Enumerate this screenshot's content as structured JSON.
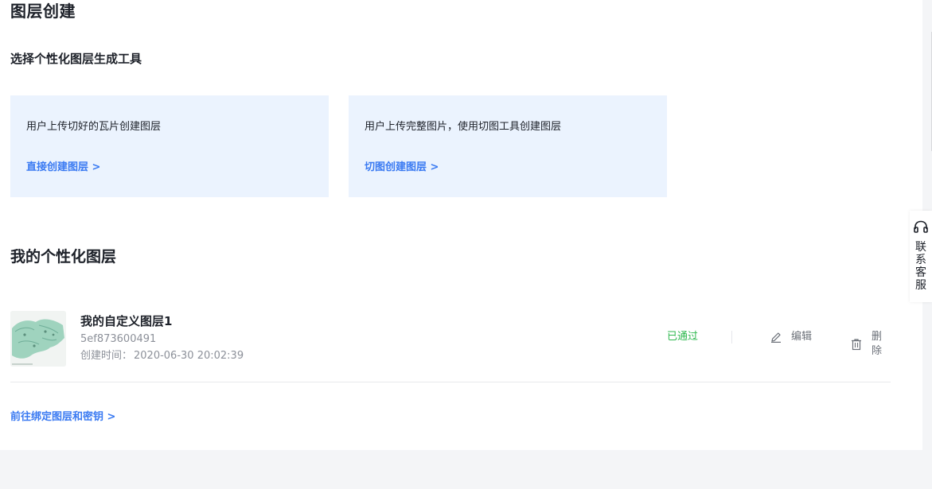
{
  "page_title": "图层创建",
  "tools_section": {
    "subtitle": "选择个性化图层生成工具",
    "cards": [
      {
        "description": "用户上传切好的瓦片创建图层",
        "link": "直接创建图层 >"
      },
      {
        "description": "用户上传完整图片，使用切图工具创建图层",
        "link": "切图创建图层 >"
      }
    ]
  },
  "my_layers": {
    "title": "我的个性化图层",
    "items": [
      {
        "name": "我的自定义图层1",
        "id": "5ef873600491",
        "created_label": "创建时间：",
        "created_value": "2020-06-30 20:02:39",
        "status": "已通过",
        "edit_label": "编辑",
        "delete_label": "删除"
      }
    ]
  },
  "bind_link": "前往绑定图层和密钥 >",
  "side_service": {
    "label": "联系客服",
    "icon": "headset-icon"
  },
  "colors": {
    "accent": "#3a7af2",
    "success": "#2fb84f",
    "card_bg": "#ebf3fe",
    "page_bg": "#f4f5f7"
  }
}
